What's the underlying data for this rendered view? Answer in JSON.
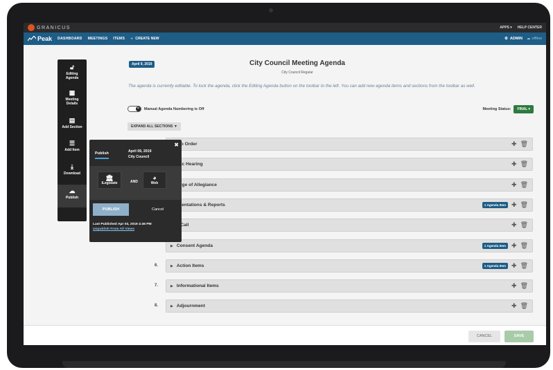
{
  "topbar": {
    "brand": "GRANICUS",
    "links": [
      "APPS ▾",
      "HELP CENTER"
    ]
  },
  "nav": {
    "logo": "Peak",
    "items": [
      "DASHBOARD",
      "MEETINGS",
      "ITEMS"
    ],
    "create": "CREATE NEW",
    "admin": "ADMIN",
    "offline": "offline"
  },
  "toolbar": {
    "editing": [
      "Editing",
      "Agenda"
    ],
    "meeting": [
      "Meeting",
      "Details"
    ],
    "add_section": "Add Section",
    "add_item": "Add Item",
    "download": "Download",
    "publish": "Publish"
  },
  "header": {
    "date_badge": "April 9, 2019",
    "title": "City Council Meeting Agenda",
    "subtitle": "City Council Regular",
    "notice": "The agenda is currently editable. To lock the agenda, click the Editing Agenda button on the toolbar to the left. You can add new agenda items and sections from the toolbar as well."
  },
  "controls": {
    "toggle_label": "Manual Agenda Numbering is Off",
    "status_label": "Meeting Status:",
    "status_value": "FINAL ▾",
    "expand": "EXPAND ALL SECTIONS ▼"
  },
  "sections": [
    {
      "num": "",
      "name": "l to Order",
      "badge": ""
    },
    {
      "num": "",
      "name": "blic Hearing",
      "badge": ""
    },
    {
      "num": "",
      "name": "edge of Allegiance",
      "badge": ""
    },
    {
      "num": "",
      "name": "esentations & Reports",
      "badge": "1 Agenda Item"
    },
    {
      "num": "",
      "name": "ll Call",
      "badge": ""
    },
    {
      "num": "",
      "name": "Consent Agenda",
      "badge": "1 Agenda Item"
    },
    {
      "num": "6.",
      "name": "Action Items",
      "badge": "1 Agenda Item"
    },
    {
      "num": "7.",
      "name": "Informational Items",
      "badge": ""
    },
    {
      "num": "8.",
      "name": "Adjournment",
      "badge": ""
    }
  ],
  "popover": {
    "tab": "Publish",
    "date": "April 09, 2019",
    "body": "City Council",
    "opt1": "iLegislate",
    "and": "AND",
    "opt2": "Web",
    "publish": "PUBLISH",
    "cancel": "Cancel",
    "last": "Last Published Apr 03, 2019 4:46 PM",
    "unpublish": "Unpublish From All Views"
  },
  "footer": {
    "cancel": "CANCEL",
    "save": "SAVE"
  }
}
